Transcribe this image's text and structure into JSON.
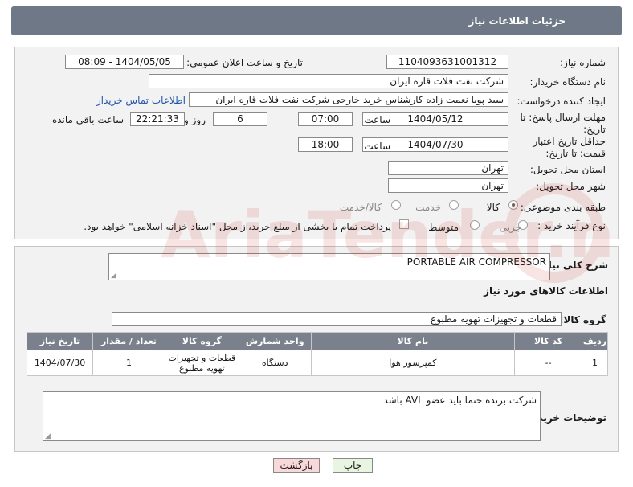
{
  "header": {
    "title": "جزئیات اطلاعات نیاز"
  },
  "info": {
    "need_number_label": "شماره نیاز:",
    "need_number": "1104093631001312",
    "announce_label": "تاریخ و ساعت اعلان عمومی:",
    "announce_value": "1404/05/05 - 08:09",
    "buyer_label": "نام دستگاه خریدار:",
    "buyer_value": "شرکت نفت فلات قاره ایران",
    "creator_label": "ایجاد کننده درخواست:",
    "creator_value": "سید پویا نعمت زاده کارشناس خرید خارجی شرکت نفت فلات قاره ایران",
    "contact_link": "اطلاعات تماس خریدار",
    "deadline_label": "مهلت ارسال پاسخ: تا تاریخ:",
    "deadline_date": "1404/05/12",
    "time_label": "ساعت",
    "deadline_time": "07:00",
    "days_value": "6",
    "days_label": "روز و",
    "remaining_value": "22:21:33",
    "remaining_label": "ساعت باقی مانده",
    "validity_label": "حداقل تاریخ اعتبار قیمت: تا تاریخ:",
    "validity_date": "1404/07/30",
    "validity_time": "18:00",
    "province_label": "استان محل تحویل:",
    "province_value": "تهران",
    "city_label": "شهر محل تحویل:",
    "city_value": "تهران",
    "category_label": "طبقه بندی موضوعی:",
    "category_options": [
      "کالا",
      "خدمت",
      "کالا/خدمت"
    ],
    "category_selected": "کالا",
    "process_label": "نوع فرآیند خرید :",
    "process_options": [
      "جزیی",
      "متوسط"
    ],
    "payment_note": "پرداخت تمام یا بخشی از مبلغ خرید،از محل \"اسناد خزانه اسلامی\" خواهد بود."
  },
  "description": {
    "general_label": "شرح کلی نیاز:",
    "general_value": "PORTABLE AIR COMPRESSOR",
    "goods_info_label": "اطلاعات کالاهای مورد نیاز",
    "goods_group_label": "گروه کالا:",
    "goods_group_value": "قطعات و تجهیزات تهویه مطبوع"
  },
  "table": {
    "headers": [
      "ردیف",
      "کد کالا",
      "نام کالا",
      "واحد شمارش",
      "گروه کالا",
      "تعداد / مقدار",
      "تاریخ نیاز"
    ],
    "rows": [
      [
        "1",
        "--",
        "کمپرسور هوا",
        "دستگاه",
        "قطعات و تجهیزات تهویه مطبوع",
        "1",
        "1404/07/30"
      ]
    ]
  },
  "buyer_notes": {
    "label": "توضیحات خریدار:",
    "value": "شرکت برنده حتما باید عضو AVL باشد"
  },
  "buttons": {
    "print": "چاپ",
    "back": "بازگشت"
  },
  "watermark_text": "AriaTender.net",
  "colors": {
    "header": "#6e7887",
    "table_header": "#7a818d",
    "link": "#2255aa",
    "back_button": "#f8d8d8",
    "print_button": "#e8f5e0"
  }
}
